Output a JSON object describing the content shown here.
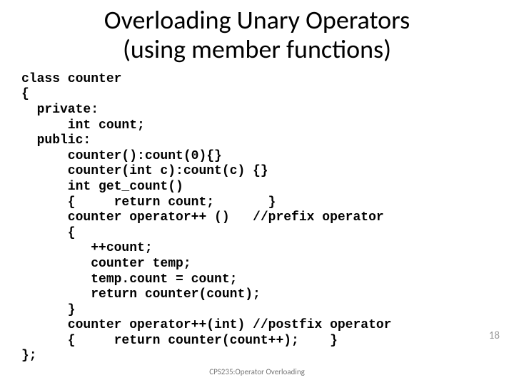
{
  "title_line1": "Overloading Unary Operators",
  "title_line2": "(using member functions)",
  "code": "class counter\n{\n  private:\n      int count;\n  public:\n      counter():count(0){}\n      counter(int c):count(c) {}\n      int get_count()\n      {     return count;       }\n      counter operator++ ()   //prefix operator\n      {\n         ++count;\n         counter temp;\n         temp.count = count;\n         return counter(count);\n      }\n      counter operator++(int) //postfix operator\n      {     return counter(count++);    }\n};",
  "footer": "CPS235:Operator Overloading",
  "page": "18"
}
